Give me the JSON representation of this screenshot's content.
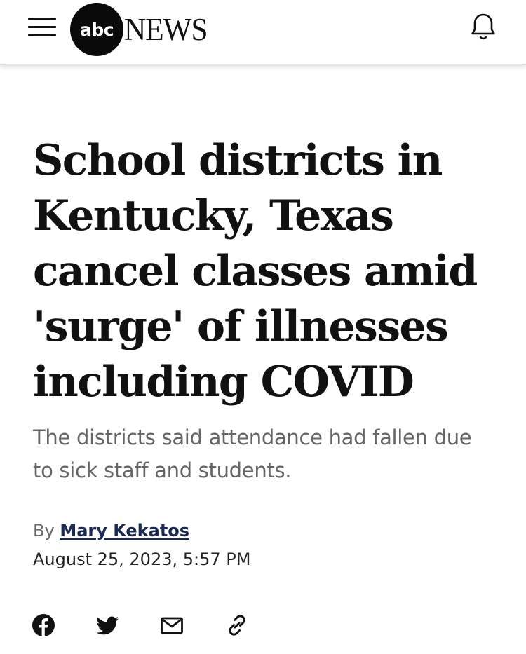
{
  "header": {
    "logo_abc": "abc",
    "logo_news": "NEWS",
    "menu_icon": "hamburger-menu-icon",
    "notification_icon": "bell-icon"
  },
  "article": {
    "headline": "School districts in Kentucky, Texas cancel classes amid 'surge' of illnesses including COVID",
    "subheadline": "The districts said attendance had fallen due to sick staff and students.",
    "byline_prefix": "By",
    "author": "Mary Kekatos",
    "date": "August 25, 2023, 5:57 PM"
  },
  "share": {
    "icons": [
      "facebook-icon",
      "twitter-icon",
      "email-icon",
      "link-icon"
    ]
  },
  "colors": {
    "text_primary": "#111111",
    "text_secondary": "#666666",
    "author_link": "#1b2a55",
    "logo_bg": "#0a0a0a"
  }
}
